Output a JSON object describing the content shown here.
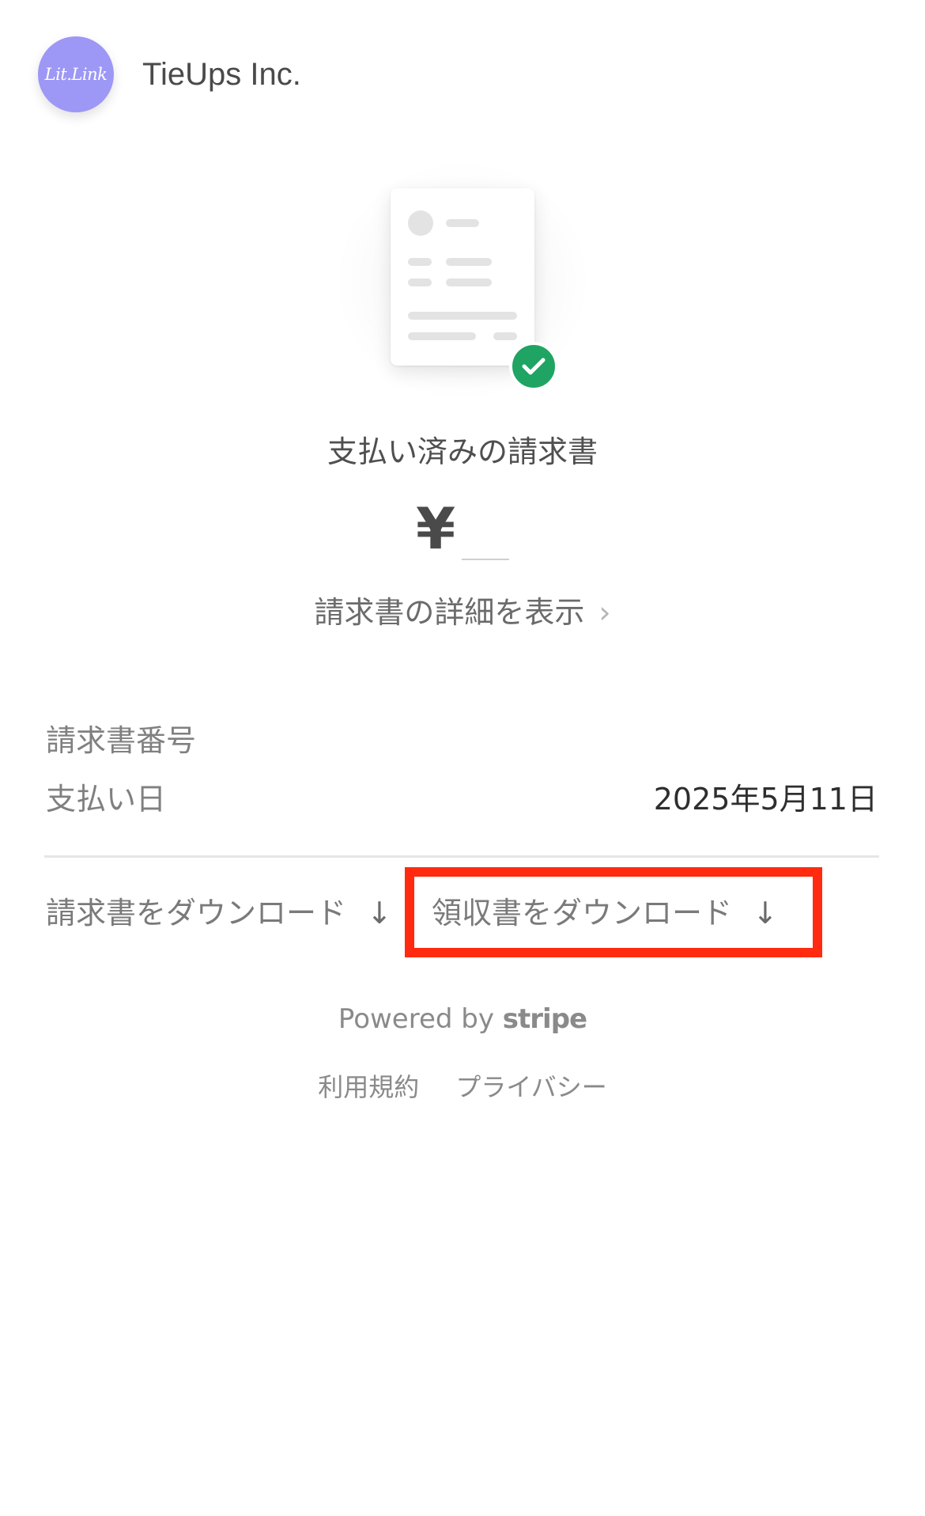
{
  "header": {
    "logo_text": "Lit.Link",
    "merchant_name": "TieUps Inc."
  },
  "status": {
    "title": "支払い済みの請求書",
    "currency_symbol": "¥",
    "details_link": "請求書の詳細を表示",
    "details_chevron": "›"
  },
  "summary": {
    "rows": [
      {
        "label": "請求書番号",
        "value": ""
      },
      {
        "label": "支払い日",
        "value": "2025年5月11日"
      }
    ]
  },
  "actions": {
    "download_invoice": "請求書をダウンロード",
    "download_receipt": "領収書をダウンロード",
    "arrow": "↓"
  },
  "footer": {
    "powered_by": "Powered by",
    "brand": "stripe",
    "links": [
      "利用規約",
      "プライバシー"
    ]
  },
  "colors": {
    "logo_bg": "#9d98f5",
    "check_green": "#1fa463",
    "highlight_red": "#ff2a0f"
  }
}
